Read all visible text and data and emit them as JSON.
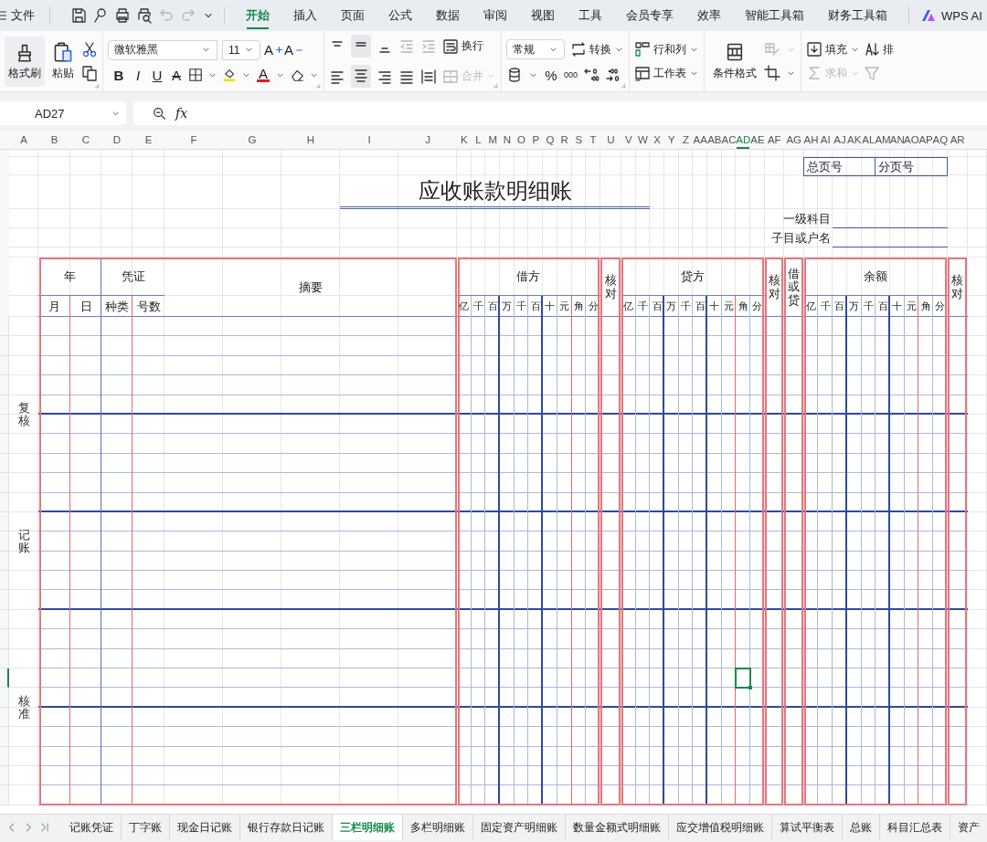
{
  "menu": {
    "label": "文件"
  },
  "ribbon_tabs": [
    {
      "label": "开始",
      "selected": true
    },
    {
      "label": "插入",
      "selected": false
    },
    {
      "label": "页面",
      "selected": false
    },
    {
      "label": "公式",
      "selected": false
    },
    {
      "label": "数据",
      "selected": false
    },
    {
      "label": "审阅",
      "selected": false
    },
    {
      "label": "视图",
      "selected": false
    },
    {
      "label": "工具",
      "selected": false
    },
    {
      "label": "会员专享",
      "selected": false
    },
    {
      "label": "效率",
      "selected": false
    },
    {
      "label": "智能工具箱",
      "selected": false
    },
    {
      "label": "财务工具箱",
      "selected": false
    }
  ],
  "ai_button": {
    "label": "WPS AI"
  },
  "ribbon": {
    "clipboard": {
      "format_painter": "格式刷",
      "paste": "粘贴"
    },
    "font": {
      "name": "微软雅黑",
      "size": "11",
      "grow": "A",
      "shrink": "A",
      "styles": [
        {
          "kind": "bold",
          "label": "B"
        },
        {
          "kind": "italic",
          "label": "I"
        },
        {
          "kind": "underline",
          "label": "U"
        },
        {
          "kind": "strike",
          "label": "A"
        }
      ],
      "font_color": "A"
    },
    "alignment": {
      "wrap": {
        "label": "换行",
        "disabled": false
      },
      "merge": {
        "label": "合并",
        "disabled": true
      }
    },
    "number": {
      "format": "常规",
      "convert": "转换",
      "percent": "%",
      "thousands": "000"
    },
    "cells": {
      "rows_cols": "行和列",
      "worksheet": "工作表"
    },
    "styles": {
      "conditional_format": "条件格式"
    },
    "editing": {
      "fill": {
        "label": "填充",
        "disabled": false
      },
      "sum": {
        "label": "求和",
        "disabled": true
      },
      "sort": "排"
    }
  },
  "formula_bar": {
    "name_box": "AD27",
    "fx": "fx"
  },
  "columns": [
    {
      "label": "A",
      "selected": false
    },
    {
      "label": "B",
      "selected": false
    },
    {
      "label": "C",
      "selected": false
    },
    {
      "label": "D",
      "selected": false
    },
    {
      "label": "E",
      "selected": false
    },
    {
      "label": "F",
      "selected": false
    },
    {
      "label": "G",
      "selected": false
    },
    {
      "label": "H",
      "selected": false
    },
    {
      "label": "I",
      "selected": false
    },
    {
      "label": "J",
      "selected": false
    },
    {
      "label": "K",
      "selected": false
    },
    {
      "label": "L",
      "selected": false
    },
    {
      "label": "M",
      "selected": false
    },
    {
      "label": "N",
      "selected": false
    },
    {
      "label": "O",
      "selected": false
    },
    {
      "label": "P",
      "selected": false
    },
    {
      "label": "Q",
      "selected": false
    },
    {
      "label": "R",
      "selected": false
    },
    {
      "label": "S",
      "selected": false
    },
    {
      "label": "T",
      "selected": false
    },
    {
      "label": "U",
      "selected": false
    },
    {
      "label": "V",
      "selected": false
    },
    {
      "label": "W",
      "selected": false
    },
    {
      "label": "X",
      "selected": false
    },
    {
      "label": "Y",
      "selected": false
    },
    {
      "label": "Z",
      "selected": false
    },
    {
      "label": "AA",
      "selected": false
    },
    {
      "label": "AB",
      "selected": false
    },
    {
      "label": "AC",
      "selected": false
    },
    {
      "label": "AD",
      "selected": true
    },
    {
      "label": "AE",
      "selected": false
    },
    {
      "label": "AF",
      "selected": false
    },
    {
      "label": "AG",
      "selected": false
    },
    {
      "label": "AH",
      "selected": false
    },
    {
      "label": "AI",
      "selected": false
    },
    {
      "label": "AJ",
      "selected": false
    },
    {
      "label": "AK",
      "selected": false
    },
    {
      "label": "AL",
      "selected": false
    },
    {
      "label": "AM",
      "selected": false
    },
    {
      "label": "AN",
      "selected": false
    },
    {
      "label": "AO",
      "selected": false
    },
    {
      "label": "AP",
      "selected": false
    },
    {
      "label": "AQ",
      "selected": false
    },
    {
      "label": "AR",
      "selected": false
    }
  ],
  "sheet": {
    "page_fields": [
      "总页号",
      "分页号"
    ],
    "title": "应收账款明细账",
    "subject_fields": [
      "一级科目",
      "子目或户名"
    ],
    "side_labels": [
      "复核",
      "记账",
      "核准"
    ],
    "ledger": {
      "year": "年",
      "voucher": "凭证",
      "month": "月",
      "day": "日",
      "voucher_type": "种类",
      "voucher_no": "号数",
      "summary": "摘要",
      "sections": [
        {
          "kind": "amount",
          "title": "借方",
          "digits": [
            "亿",
            "千",
            "百",
            "万",
            "千",
            "百",
            "十",
            "元",
            "角",
            "分"
          ]
        },
        {
          "kind": "check",
          "title": "核对"
        },
        {
          "kind": "amount",
          "title": "贷方",
          "digits": [
            "亿",
            "千",
            "百",
            "万",
            "千",
            "百",
            "十",
            "元",
            "角",
            "分"
          ]
        },
        {
          "kind": "check",
          "title": "核对"
        },
        {
          "kind": "direction",
          "title": "借或贷"
        },
        {
          "kind": "amount",
          "title": "余额",
          "digits": [
            "亿",
            "千",
            "百",
            "万",
            "千",
            "百",
            "十",
            "元",
            "角",
            "分"
          ]
        },
        {
          "kind": "check",
          "title": "核对"
        }
      ]
    },
    "body_rows": [
      {
        "selected": false
      },
      {
        "selected": false
      },
      {
        "selected": false
      },
      {
        "selected": false
      },
      {
        "selected": false
      },
      {
        "selected": false
      },
      {
        "selected": false
      },
      {
        "selected": false
      },
      {
        "selected": false
      },
      {
        "selected": false
      },
      {
        "selected": false
      },
      {
        "selected": false
      },
      {
        "selected": false
      },
      {
        "selected": false
      },
      {
        "selected": false
      },
      {
        "selected": false
      },
      {
        "selected": false
      },
      {
        "selected": false
      },
      {
        "selected": true
      },
      {
        "selected": false
      },
      {
        "selected": false
      },
      {
        "selected": false
      },
      {
        "selected": false
      },
      {
        "selected": false
      },
      {
        "selected": false
      }
    ]
  },
  "sheet_tabs": [
    {
      "label": "记账凭证",
      "selected": false
    },
    {
      "label": "丁字账",
      "selected": false
    },
    {
      "label": "现金日记账",
      "selected": false
    },
    {
      "label": "银行存款日记账",
      "selected": false
    },
    {
      "label": "三栏明细账",
      "selected": true
    },
    {
      "label": "多栏明细账",
      "selected": false
    },
    {
      "label": "固定资产明细账",
      "selected": false
    },
    {
      "label": "数量金额式明细账",
      "selected": false
    },
    {
      "label": "应交增值税明细账",
      "selected": false
    },
    {
      "label": "算试平衡表",
      "selected": false
    },
    {
      "label": "总账",
      "selected": false
    },
    {
      "label": "科目汇总表",
      "selected": false
    },
    {
      "label": "资产",
      "selected": false
    }
  ]
}
